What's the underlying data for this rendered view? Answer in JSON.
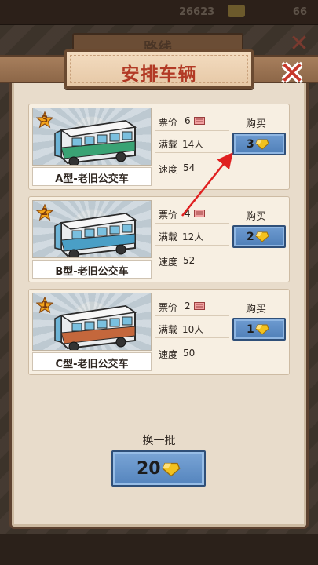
{
  "background": {
    "money_value": "26623",
    "gems_value": "66",
    "route_title": "路线"
  },
  "dialog": {
    "title": "安排车辆",
    "close_icon": "close-x-icon"
  },
  "buses": [
    {
      "rank": "3",
      "name": "A型-老旧公交车",
      "fare_label": "票价",
      "fare_value": "6",
      "capacity_label": "满载",
      "capacity_value": "14人",
      "speed_label": "速度",
      "speed_value": "54",
      "buy_label": "购买",
      "price": "3",
      "stripe_color": "#3aa374"
    },
    {
      "rank": "2",
      "name": "B型-老旧公交车",
      "fare_label": "票价",
      "fare_value": "4",
      "capacity_label": "满载",
      "capacity_value": "12人",
      "speed_label": "速度",
      "speed_value": "52",
      "buy_label": "购买",
      "price": "2",
      "stripe_color": "#4a9fc6"
    },
    {
      "rank": "1",
      "name": "C型-老旧公交车",
      "fare_label": "票价",
      "fare_value": "2",
      "capacity_label": "满载",
      "capacity_value": "10人",
      "speed_label": "速度",
      "speed_value": "50",
      "buy_label": "购买",
      "price": "1",
      "stripe_color": "#c4673c"
    }
  ],
  "refresh": {
    "label": "换一批",
    "price": "20"
  },
  "colors": {
    "title_red": "#b23a25",
    "button_blue": "#5484bd",
    "gem_gold": "#f3c21d",
    "arrow_red": "#e02020"
  }
}
